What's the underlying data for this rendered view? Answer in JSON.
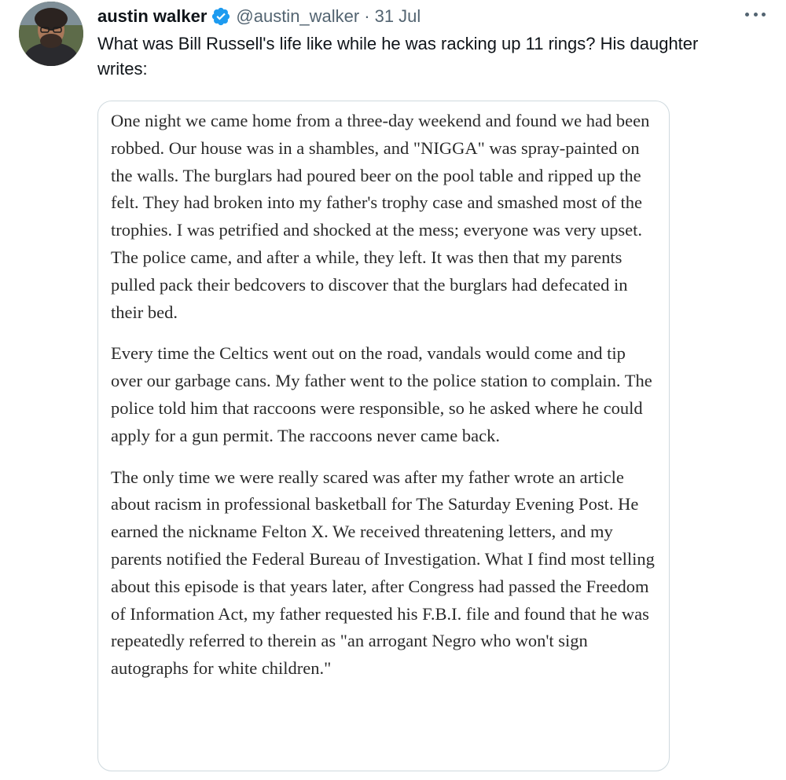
{
  "tweet": {
    "display_name": "austin walker",
    "verified_icon": "verified-badge-icon",
    "handle": "@austin_walker",
    "separator": "·",
    "date": "31 Jul",
    "text": "What was Bill Russell's life like while he was racking up 11 rings? His daughter writes:",
    "more_icon": "more-options-icon"
  },
  "quote": {
    "paragraphs": [
      "One night we came home from a three-day weekend and found we had been robbed. Our house was in a shambles, and \"NIGGA\" was spray-painted on the walls. The burglars had poured beer on the pool table and ripped up the felt. They had broken into my father's trophy case and smashed most of the trophies. I was petrified and shocked at the mess; everyone was very upset. The police came, and after a while, they left. It was then that my parents pulled pack their bedcovers to discover that the burglars had defecated in their bed.",
      "Every time the Celtics went out on the road, vandals would come and tip over our garbage cans. My father went to the police station to complain. The police told him that raccoons were responsible, so he asked where he could apply for a gun permit. The raccoons never came back.",
      "The only time we were really scared was after my father wrote an article about racism in professional basketball for The Saturday Evening Post. He earned the nickname Felton X. We received threatening letters, and my parents notified the Federal Bureau of Investigation. What I find most telling about this episode is that years later, after Congress had passed the Freedom of Information Act, my father requested his F.B.I. file and found that he was repeatedly referred to therein as \"an arrogant Negro who won't sign autographs for white children.\""
    ]
  },
  "colors": {
    "text_primary": "#0f1419",
    "text_secondary": "#536471",
    "verified_blue": "#1d9bf0",
    "card_border": "#cfd9de"
  }
}
